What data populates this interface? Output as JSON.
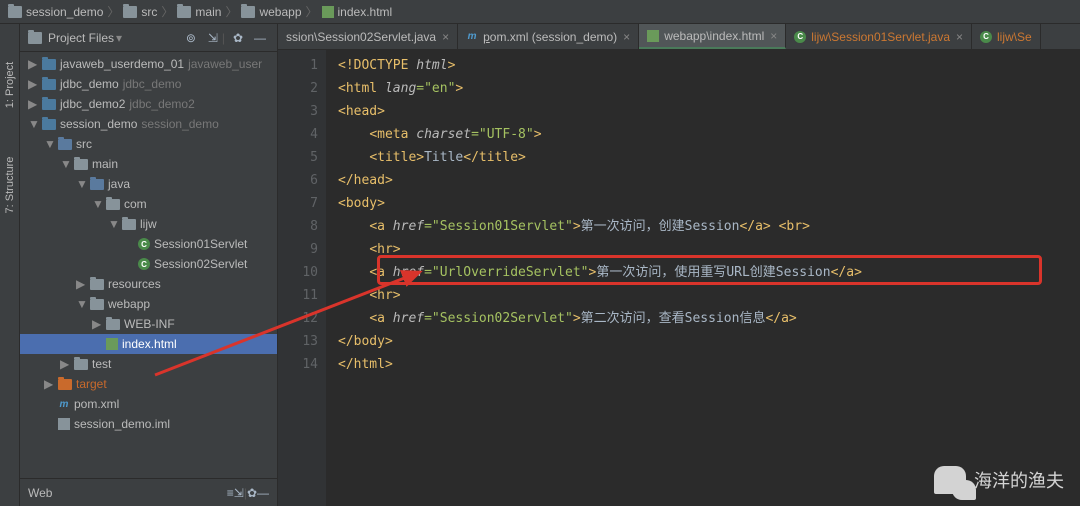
{
  "breadcrumb": {
    "items": [
      "session_demo",
      "src",
      "main",
      "webapp",
      "index.html"
    ]
  },
  "toolstrip": {
    "project": "1: Project",
    "structure": "7: Structure"
  },
  "sidebar": {
    "header": "Project Files",
    "footer_label": "Web",
    "items": [
      {
        "depth": 0,
        "arrow": "▶",
        "icon": "module",
        "label": "javaweb_userdemo_01",
        "muted": "javaweb_user"
      },
      {
        "depth": 0,
        "arrow": "▶",
        "icon": "module",
        "label": "jdbc_demo",
        "muted": "jdbc_demo"
      },
      {
        "depth": 0,
        "arrow": "▶",
        "icon": "module",
        "label": "jdbc_demo2",
        "muted": "jdbc_demo2"
      },
      {
        "depth": 0,
        "arrow": "▼",
        "icon": "module",
        "label": "session_demo",
        "muted": "session_demo"
      },
      {
        "depth": 1,
        "arrow": "▼",
        "icon": "src",
        "label": "src"
      },
      {
        "depth": 2,
        "arrow": "▼",
        "icon": "folder",
        "label": "main"
      },
      {
        "depth": 3,
        "arrow": "▼",
        "icon": "src",
        "label": "java"
      },
      {
        "depth": 4,
        "arrow": "▼",
        "icon": "pkg",
        "label": "com"
      },
      {
        "depth": 5,
        "arrow": "▼",
        "icon": "pkg",
        "label": "lijw"
      },
      {
        "depth": 6,
        "arrow": "",
        "icon": "class",
        "label": "Session01Servlet"
      },
      {
        "depth": 6,
        "arrow": "",
        "icon": "class",
        "label": "Session02Servlet"
      },
      {
        "depth": 3,
        "arrow": "▶",
        "icon": "folder",
        "label": "resources"
      },
      {
        "depth": 3,
        "arrow": "▼",
        "icon": "folder",
        "label": "webapp"
      },
      {
        "depth": 4,
        "arrow": "▶",
        "icon": "folder",
        "label": "WEB-INF"
      },
      {
        "depth": 4,
        "arrow": "",
        "icon": "html",
        "label": "index.html",
        "selected": true
      },
      {
        "depth": 2,
        "arrow": "▶",
        "icon": "folder",
        "label": "test"
      },
      {
        "depth": 1,
        "arrow": "▶",
        "icon": "target",
        "label": "target",
        "target": true
      },
      {
        "depth": 1,
        "arrow": "",
        "icon": "pom",
        "label": "pom.xml"
      },
      {
        "depth": 1,
        "arrow": "",
        "icon": "iml",
        "label": "session_demo.iml"
      }
    ]
  },
  "tabs": [
    {
      "type": "partial",
      "label": "ssion\\Session02Servlet.java",
      "close": true
    },
    {
      "type": "pom",
      "label": "pom.xml (session_demo)",
      "underline": "p",
      "close": true
    },
    {
      "type": "html",
      "label": "webapp\\index.html",
      "active": true,
      "close": true
    },
    {
      "type": "class",
      "label": "lijw\\Session01Servlet.java",
      "lib": true,
      "close": true
    },
    {
      "type": "class",
      "label": "lijw\\Se",
      "lib": true,
      "close": false
    }
  ],
  "code": {
    "lines": [
      {
        "n": 1,
        "html": "<span class='t-doctype'>&lt;!DOCTYPE</span> <span class='t-attr'>html</span><span class='t-doctype'>&gt;</span>"
      },
      {
        "n": 2,
        "html": "<span class='t-tag'>&lt;html</span> <span class='t-attr'>lang</span><span class='t-val'>=\"en\"</span><span class='t-tag'>&gt;</span>"
      },
      {
        "n": 3,
        "html": "<span class='t-tag'>&lt;head&gt;</span>"
      },
      {
        "n": 4,
        "html": "    <span class='t-tag'>&lt;meta</span> <span class='t-attr'>charset</span><span class='t-val'>=\"UTF-8\"</span><span class='t-tag'>&gt;</span>"
      },
      {
        "n": 5,
        "html": "    <span class='t-tag'>&lt;title&gt;</span><span class='t-text'>Title</span><span class='t-tag'>&lt;/title&gt;</span>"
      },
      {
        "n": 6,
        "html": "<span class='t-tag'>&lt;/head&gt;</span>"
      },
      {
        "n": 7,
        "html": "<span class='t-tag'>&lt;body&gt;</span>"
      },
      {
        "n": 8,
        "html": "    <span class='t-tag'>&lt;a</span> <span class='t-attr'>href</span><span class='t-val'>=\"Session01Servlet\"</span><span class='t-tag'>&gt;</span><span class='t-text'>第一次访问，创建Session</span><span class='t-tag'>&lt;/a&gt;</span> <span class='t-tag'>&lt;br&gt;</span>"
      },
      {
        "n": 9,
        "html": "    <span class='t-tag'>&lt;hr&gt;</span>"
      },
      {
        "n": 10,
        "html": "    <span class='t-tag'>&lt;a</span> <span class='t-attr'>href</span><span class='t-val'>=\"UrlOverrideServlet\"</span><span class='t-tag'>&gt;</span><span class='t-text'>第一次访问，使用重写URL创建Session</span><span class='t-tag'>&lt;/a&gt;</span>"
      },
      {
        "n": 11,
        "html": "    <span class='t-tag'>&lt;hr&gt;</span>"
      },
      {
        "n": 12,
        "html": "    <span class='t-tag'>&lt;a</span> <span class='t-attr'>href</span><span class='t-val'>=\"Session02Servlet\"</span><span class='t-tag'>&gt;</span><span class='t-text'>第二次访问，查看Session信息</span><span class='t-tag'>&lt;/a&gt;</span>"
      },
      {
        "n": 13,
        "html": "<span class='t-tag'>&lt;/body&gt;</span>"
      },
      {
        "n": 14,
        "html": "<span class='t-tag'>&lt;/html&gt;</span>"
      }
    ]
  },
  "watermark": "海洋的渔夫"
}
